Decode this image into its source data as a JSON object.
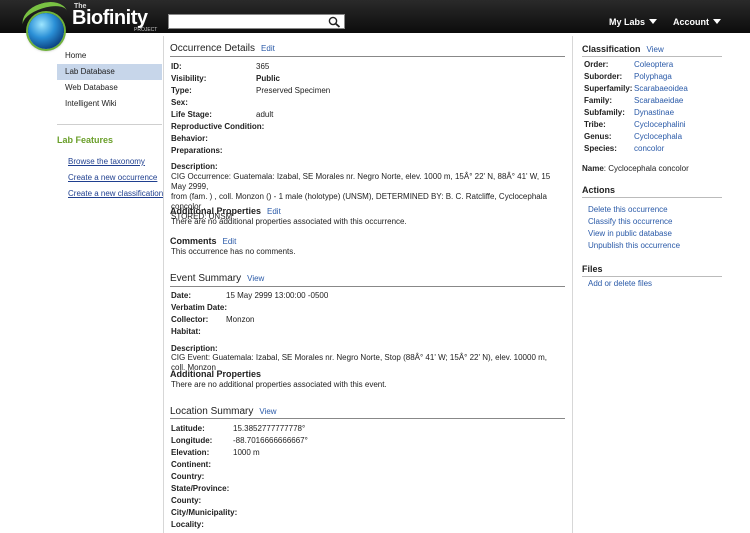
{
  "header": {
    "logo_the": "The",
    "logo_name": "Biofinity",
    "logo_project": "PROJECT",
    "search_placeholder": "",
    "my_labs": "My Labs",
    "account": "Account"
  },
  "leftnav": {
    "items": [
      "Home",
      "Lab Database",
      "Web Database",
      "Intelligent Wiki"
    ],
    "lab_features_title": "Lab Features",
    "lab_features": [
      "Browse the taxonomy",
      "Create a new occurrence",
      "Create a new classification"
    ]
  },
  "occurrence": {
    "title": "Occurrence Details",
    "edit": "Edit",
    "fields": [
      {
        "label": "ID:",
        "value": "365"
      },
      {
        "label": "Visibility:",
        "value": "Public"
      },
      {
        "label": "Type:",
        "value": "Preserved Specimen"
      },
      {
        "label": "Sex:",
        "value": ""
      },
      {
        "label": "Life Stage:",
        "value": "adult"
      },
      {
        "label": "Reproductive Condition:",
        "value": ""
      },
      {
        "label": "Behavior:",
        "value": ""
      },
      {
        "label": "Preparations:",
        "value": ""
      }
    ],
    "description_label": "Description:",
    "description_lines": [
      "CIG Occurrence: Guatemala: Izabal, SE Morales nr. Negro Norte, elev. 1000 m, 15Â° 22' N, 88Â° 41' W, 15 May 2999,",
      "from (fam. ) , coll. Monzon () - 1 male (holotype) (UNSM), DETERMINED BY: B. C. Ratcliffe, Cyclocephala concolor ,",
      "STORED: UNSM"
    ],
    "additional_title": "Additional Properties",
    "additional_edit": "Edit",
    "additional_text": "There are no additional properties associated with this occurrence.",
    "comments_title": "Comments",
    "comments_edit": "Edit",
    "comments_text": "This occurrence has no comments."
  },
  "event": {
    "title": "Event Summary",
    "view": "View",
    "fields": [
      {
        "label": "Date:",
        "value": "15 May 2999 13:00:00 -0500"
      },
      {
        "label": "Verbatim Date:",
        "value": ""
      },
      {
        "label": "Collector:",
        "value": "Monzon"
      },
      {
        "label": "Habitat:",
        "value": ""
      }
    ],
    "description_label": "Description:",
    "description_text": "CIG Event: Guatemala: Izabal, SE Morales nr. Negro Norte, Stop (88Â° 41' W; 15Â° 22' N), elev. 10000 m, coll. Monzon",
    "additional_title": "Additional Properties",
    "additional_text": "There are no additional properties associated with this event."
  },
  "location": {
    "title": "Location Summary",
    "view": "View",
    "fields": [
      {
        "label": "Latitude:",
        "value": "15.3852777777778°"
      },
      {
        "label": "Longitude:",
        "value": "-88.7016666666667°"
      },
      {
        "label": "Elevation:",
        "value": "1000 m"
      },
      {
        "label": "Continent:",
        "value": ""
      },
      {
        "label": "Country:",
        "value": ""
      },
      {
        "label": "State/Province:",
        "value": ""
      },
      {
        "label": "County:",
        "value": ""
      },
      {
        "label": "City/Municipality:",
        "value": ""
      },
      {
        "label": "Locality:",
        "value": ""
      }
    ]
  },
  "classification": {
    "title": "Classification",
    "view": "View",
    "ranks": [
      {
        "label": "Order:",
        "value": "Coleoptera"
      },
      {
        "label": "Suborder:",
        "value": "Polyphaga"
      },
      {
        "label": "Superfamily:",
        "value": "Scarabaeoidea"
      },
      {
        "label": "Family:",
        "value": "Scarabaeidae"
      },
      {
        "label": "Subfamily:",
        "value": "Dynastinae"
      },
      {
        "label": "Tribe:",
        "value": "Cyclocephalini"
      },
      {
        "label": "Genus:",
        "value": "Cyclocephala"
      },
      {
        "label": "Species:",
        "value": "concolor"
      }
    ],
    "name_label": "Name",
    "name_value": ": Cyclocephala concolor"
  },
  "actions": {
    "title": "Actions",
    "items": [
      "Delete this occurrence",
      "Classify this occurrence",
      "View in public database",
      "Unpublish this occurrence"
    ]
  },
  "files": {
    "title": "Files",
    "items": [
      "Add or delete files"
    ]
  }
}
